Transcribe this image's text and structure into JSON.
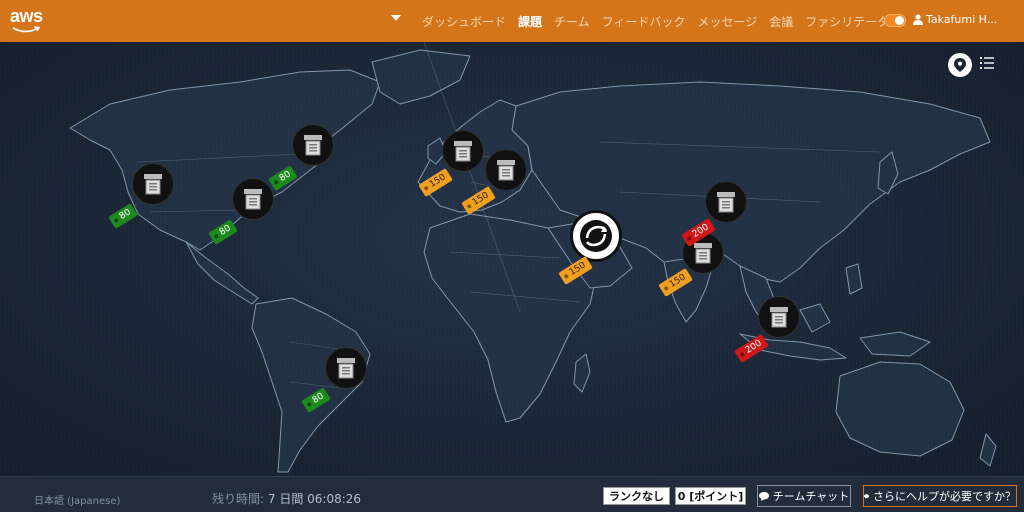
{
  "header": {
    "logo_text": "aws",
    "nav": [
      "ダッシュボード",
      "課題",
      "チーム",
      "フィードバック",
      "メッセージ",
      "会議",
      "ファシリテーター"
    ],
    "active_nav": 1,
    "user_name": "Takafumi H..."
  },
  "colors": {
    "header": "#d5751a",
    "tag_green": "#1e8a1e",
    "tag_orange": "#f0a020",
    "tag_red": "#d01818"
  },
  "map": {
    "icons": [
      "map-pin-icon",
      "list-icon"
    ],
    "challenges": [
      {
        "id": "north-america-west",
        "points": "80",
        "color": "green"
      },
      {
        "id": "north-america-east",
        "points": "80",
        "color": "green"
      },
      {
        "id": "north-america-northeast",
        "points": "80",
        "color": "green"
      },
      {
        "id": "south-america",
        "points": "80",
        "color": "green"
      },
      {
        "id": "europe-west",
        "points": "150",
        "color": "orange"
      },
      {
        "id": "europe-south",
        "points": "150",
        "color": "orange"
      },
      {
        "id": "middle-east",
        "points": "150",
        "color": "orange"
      },
      {
        "id": "india",
        "points": "150",
        "color": "orange"
      },
      {
        "id": "south-asia",
        "points": "200",
        "color": "red"
      },
      {
        "id": "southeast-asia",
        "points": "200",
        "color": "red"
      }
    ]
  },
  "footer": {
    "language": "日本語 (Japanese)",
    "timer_label": "残り時間:",
    "timer_value": "7 日間 06:08:26",
    "rank": "ランクなし",
    "points": "0 [ポイント]",
    "team_chat": "チームチャット",
    "help": "さらにヘルプが必要ですか？"
  }
}
